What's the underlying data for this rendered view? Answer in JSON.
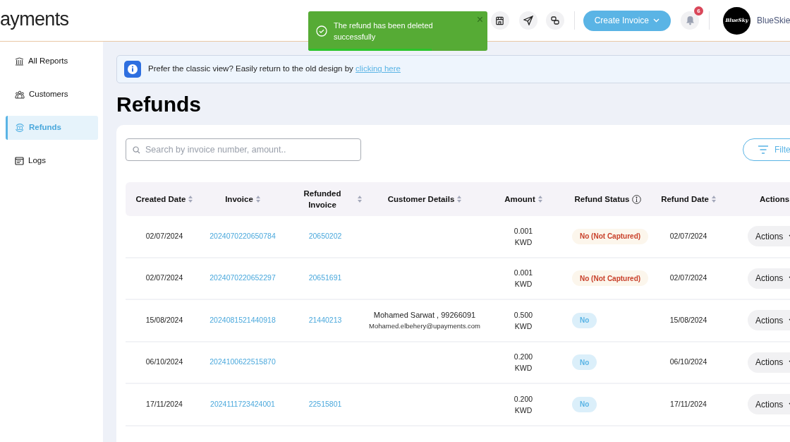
{
  "header": {
    "logo": "ayments",
    "create_button": "Create Invoice",
    "notifications": {
      "count": "6"
    },
    "avatar_text": "BlueSky",
    "account_name": "BlueSkie"
  },
  "toast": {
    "message": "The refund has been deleted successfully",
    "close": "×",
    "level": 0.69
  },
  "sidebar": {
    "items": [
      {
        "label": "All Reports",
        "selected": false
      },
      {
        "label": "Customers",
        "selected": false
      },
      {
        "label": "Refunds",
        "selected": true
      },
      {
        "label": "Logs",
        "selected": false
      }
    ]
  },
  "banner": {
    "text": "Prefer the classic view? Easily return to the old design by",
    "link": "clicking here"
  },
  "title": "Refunds",
  "search": {
    "placeholder": "Search by invoice number, amount.."
  },
  "filter_button": "Filte",
  "table": {
    "columns": [
      {
        "label": "Created Date",
        "sortable": true
      },
      {
        "label": "Invoice",
        "sortable": true
      },
      {
        "label": "Refunded Invoice",
        "sortable": true
      },
      {
        "label": "Customer Details",
        "sortable": true
      },
      {
        "label": "Amount",
        "sortable": true
      },
      {
        "label": "Refund Status",
        "sortable": false,
        "info": true
      },
      {
        "label": "Refund Date",
        "sortable": true
      },
      {
        "label": "Actions",
        "sortable": false
      }
    ],
    "rows": [
      {
        "created": "02/07/2024",
        "invoice": "2024070220650784",
        "refunded_invoice": "20650202",
        "amount": "0.001",
        "currency": "KWD",
        "status": {
          "label": "No (Not Captured)",
          "kind": "not_captured"
        },
        "refund_date": "02/07/2024",
        "action": "Actions"
      },
      {
        "created": "02/07/2024",
        "invoice": "2024070220652297",
        "refunded_invoice": "20651691",
        "amount": "0.001",
        "currency": "KWD",
        "status": {
          "label": "No (Not Captured)",
          "kind": "not_captured"
        },
        "refund_date": "02/07/2024",
        "action": "Actions"
      },
      {
        "created": "15/08/2024",
        "invoice": "2024081521440918",
        "refunded_invoice": "21440213",
        "customer_name": "Mohamed Sarwat , 99266091",
        "customer_email": "Mohamed.elbehery@upayments.com",
        "amount": "0.500",
        "currency": "KWD",
        "status": {
          "label": "No",
          "kind": "no"
        },
        "refund_date": "15/08/2024",
        "action": "Actions"
      },
      {
        "created": "06/10/2024",
        "invoice": "2024100622515870",
        "amount": "0.200",
        "currency": "KWD",
        "status": {
          "label": "No",
          "kind": "no"
        },
        "refund_date": "06/10/2024",
        "action": "Actions"
      },
      {
        "created": "17/11/2024",
        "invoice": "2024111723424001",
        "refunded_invoice": "22515801",
        "amount": "0.200",
        "currency": "KWD",
        "status": {
          "label": "No",
          "kind": "no"
        },
        "refund_date": "17/11/2024",
        "action": "Actions"
      }
    ]
  }
}
